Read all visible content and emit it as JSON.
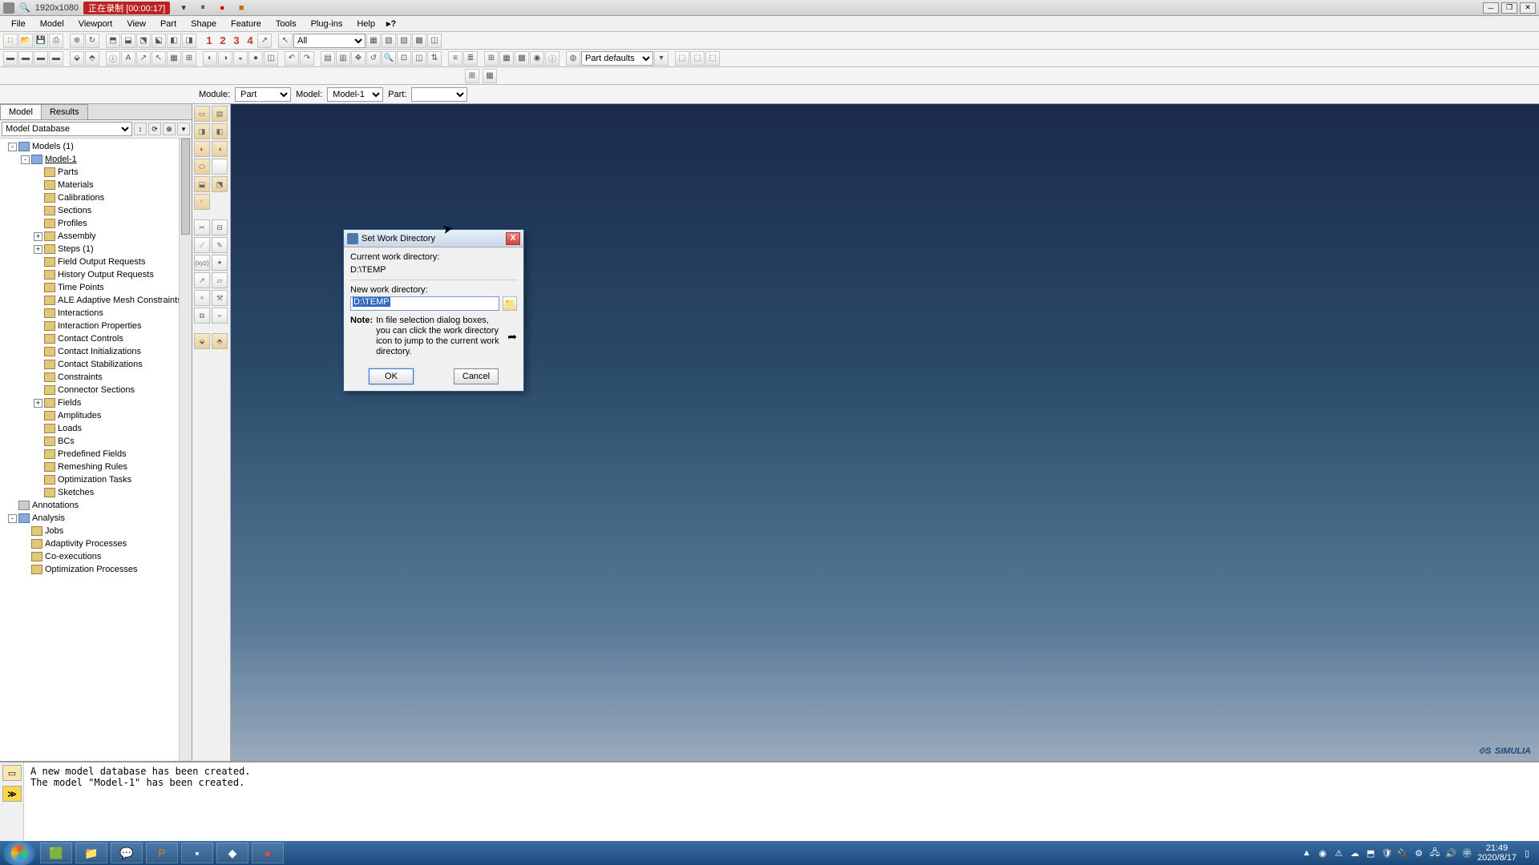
{
  "titlebar": {
    "dimensions": "1920x1080",
    "recording": "正在录制 [00:00:17]"
  },
  "menus": [
    "File",
    "Model",
    "Viewport",
    "View",
    "Part",
    "Shape",
    "Feature",
    "Tools",
    "Plug-ins",
    "Help"
  ],
  "toolbar1": {
    "numbers": [
      "1",
      "2",
      "3",
      "4"
    ],
    "filter": "All"
  },
  "toolbar2": {
    "render": "Part defaults"
  },
  "context": {
    "module_label": "Module:",
    "module": "Part",
    "model_label": "Model:",
    "model": "Model-1",
    "part_label": "Part:",
    "part": ""
  },
  "left": {
    "tabs": [
      "Model",
      "Results"
    ],
    "database": "Model Database",
    "tree": [
      {
        "d": 0,
        "exp": "-",
        "icon": "blue",
        "label": "Models (1)"
      },
      {
        "d": 1,
        "exp": "-",
        "icon": "blue",
        "label": "Model-1",
        "u": true
      },
      {
        "d": 2,
        "exp": "",
        "icon": "y",
        "label": "Parts"
      },
      {
        "d": 2,
        "exp": "",
        "icon": "y",
        "label": "Materials"
      },
      {
        "d": 2,
        "exp": "",
        "icon": "y",
        "label": "Calibrations"
      },
      {
        "d": 2,
        "exp": "",
        "icon": "y",
        "label": "Sections"
      },
      {
        "d": 2,
        "exp": "",
        "icon": "y",
        "label": "Profiles"
      },
      {
        "d": 2,
        "exp": "+",
        "icon": "y",
        "label": "Assembly"
      },
      {
        "d": 2,
        "exp": "+",
        "icon": "y",
        "label": "Steps (1)"
      },
      {
        "d": 2,
        "exp": "",
        "icon": "y",
        "label": "Field Output Requests"
      },
      {
        "d": 2,
        "exp": "",
        "icon": "y",
        "label": "History Output Requests"
      },
      {
        "d": 2,
        "exp": "",
        "icon": "y",
        "label": "Time Points"
      },
      {
        "d": 2,
        "exp": "",
        "icon": "y",
        "label": "ALE Adaptive Mesh Constraints"
      },
      {
        "d": 2,
        "exp": "",
        "icon": "y",
        "label": "Interactions"
      },
      {
        "d": 2,
        "exp": "",
        "icon": "y",
        "label": "Interaction Properties"
      },
      {
        "d": 2,
        "exp": "",
        "icon": "y",
        "label": "Contact Controls"
      },
      {
        "d": 2,
        "exp": "",
        "icon": "y",
        "label": "Contact Initializations"
      },
      {
        "d": 2,
        "exp": "",
        "icon": "y",
        "label": "Contact Stabilizations"
      },
      {
        "d": 2,
        "exp": "",
        "icon": "y",
        "label": "Constraints"
      },
      {
        "d": 2,
        "exp": "",
        "icon": "y",
        "label": "Connector Sections"
      },
      {
        "d": 2,
        "exp": "+",
        "icon": "y",
        "label": "Fields"
      },
      {
        "d": 2,
        "exp": "",
        "icon": "y",
        "label": "Amplitudes"
      },
      {
        "d": 2,
        "exp": "",
        "icon": "y",
        "label": "Loads"
      },
      {
        "d": 2,
        "exp": "",
        "icon": "y",
        "label": "BCs"
      },
      {
        "d": 2,
        "exp": "",
        "icon": "y",
        "label": "Predefined Fields"
      },
      {
        "d": 2,
        "exp": "",
        "icon": "y",
        "label": "Remeshing Rules"
      },
      {
        "d": 2,
        "exp": "",
        "icon": "y",
        "label": "Optimization Tasks"
      },
      {
        "d": 2,
        "exp": "",
        "icon": "y",
        "label": "Sketches"
      },
      {
        "d": 0,
        "exp": "",
        "icon": "grey",
        "label": "Annotations"
      },
      {
        "d": 0,
        "exp": "-",
        "icon": "blue",
        "label": "Analysis"
      },
      {
        "d": 1,
        "exp": "",
        "icon": "y",
        "label": "Jobs"
      },
      {
        "d": 1,
        "exp": "",
        "icon": "y",
        "label": "Adaptivity Processes"
      },
      {
        "d": 1,
        "exp": "",
        "icon": "y",
        "label": "Co-executions"
      },
      {
        "d": 1,
        "exp": "",
        "icon": "y",
        "label": "Optimization Processes"
      }
    ]
  },
  "messages": "A new model database has been created.\nThe model \"Model-1\" has been created.",
  "dialog": {
    "title": "Set Work Directory",
    "cur_label": "Current work directory:",
    "cur_value": "D:\\TEMP",
    "new_label": "New work directory:",
    "new_value": "D:\\TEMP",
    "note_label": "Note:",
    "note_text": "In file selection dialog boxes, you can click the work directory icon to jump to the current work directory.",
    "ok": "OK",
    "cancel": "Cancel"
  },
  "logo": "SIMULIA",
  "clock": {
    "time": "21:49",
    "date": "2020/8/17"
  }
}
